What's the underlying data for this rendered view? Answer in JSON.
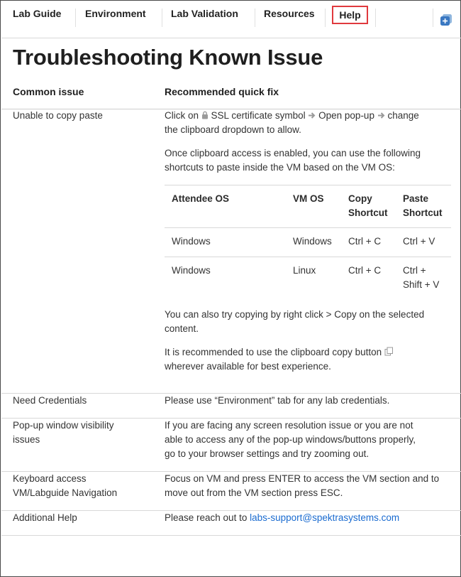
{
  "nav": {
    "tabs": [
      "Lab Guide",
      "Environment",
      "Lab Validation",
      "Resources"
    ],
    "active_tab": "Help",
    "active_color": "#e0393e",
    "expand_icon": "expand-icon"
  },
  "page": {
    "title": "Troubleshooting Known Issue",
    "col_issue": "Common issue",
    "col_fix": "Recommended quick fix"
  },
  "rows": {
    "copy_paste": {
      "issue": "Unable to copy paste",
      "fix_line1_a": "Click on",
      "fix_line1_b": "SSL certificate symbol",
      "fix_line1_c": "Open pop-up",
      "fix_line1_d": "change",
      "fix_line2": "the clipboard dropdown to allow.",
      "para2_line1": "Once clipboard access is enabled, you can use the following",
      "para2_line2": "shortcuts to paste inside the VM based on the VM OS:",
      "shortcut_table": {
        "headers": {
          "attendee_os": "Attendee OS",
          "vm_os": "VM OS",
          "copy_1": "Copy",
          "copy_2": "Shortcut",
          "paste_1": "Paste",
          "paste_2": "Shortcut"
        },
        "rows": [
          {
            "attendee_os": "Windows",
            "vm_os": "Windows",
            "copy": "Ctrl + C",
            "paste_1": "Ctrl + V",
            "paste_2": ""
          },
          {
            "attendee_os": "Windows",
            "vm_os": "Linux",
            "copy": "Ctrl + C",
            "paste_1": "Ctrl +",
            "paste_2": "Shift + V"
          }
        ]
      },
      "para3_line1": "You can also try copying by right click > Copy on the selected",
      "para3_line2": "content.",
      "para4_line1": "It is recommended to use the clipboard copy button",
      "para4_line2": "wherever available for best experience."
    },
    "credentials": {
      "issue": "Need Credentials",
      "fix": "Please use “Environment” tab for any lab credentials."
    },
    "popup": {
      "issue_line1": "Pop-up window visibility",
      "issue_line2": "issues",
      "fix_line1": "If you are facing any screen resolution issue or you are not",
      "fix_line2": "able to access any of the pop-up windows/buttons properly,",
      "fix_line3": "go to your browser settings and try zooming out."
    },
    "keyboard": {
      "issue_line1": "Keyboard access",
      "issue_line2": "VM/Labguide Navigation",
      "fix_line1": "Focus on VM and press ENTER to access the VM section and to",
      "fix_line2": "move out from the VM section press ESC."
    },
    "help": {
      "issue": "Additional Help",
      "fix_prefix": "Please reach out to",
      "email": "labs-support@spektrasystems.com"
    }
  }
}
